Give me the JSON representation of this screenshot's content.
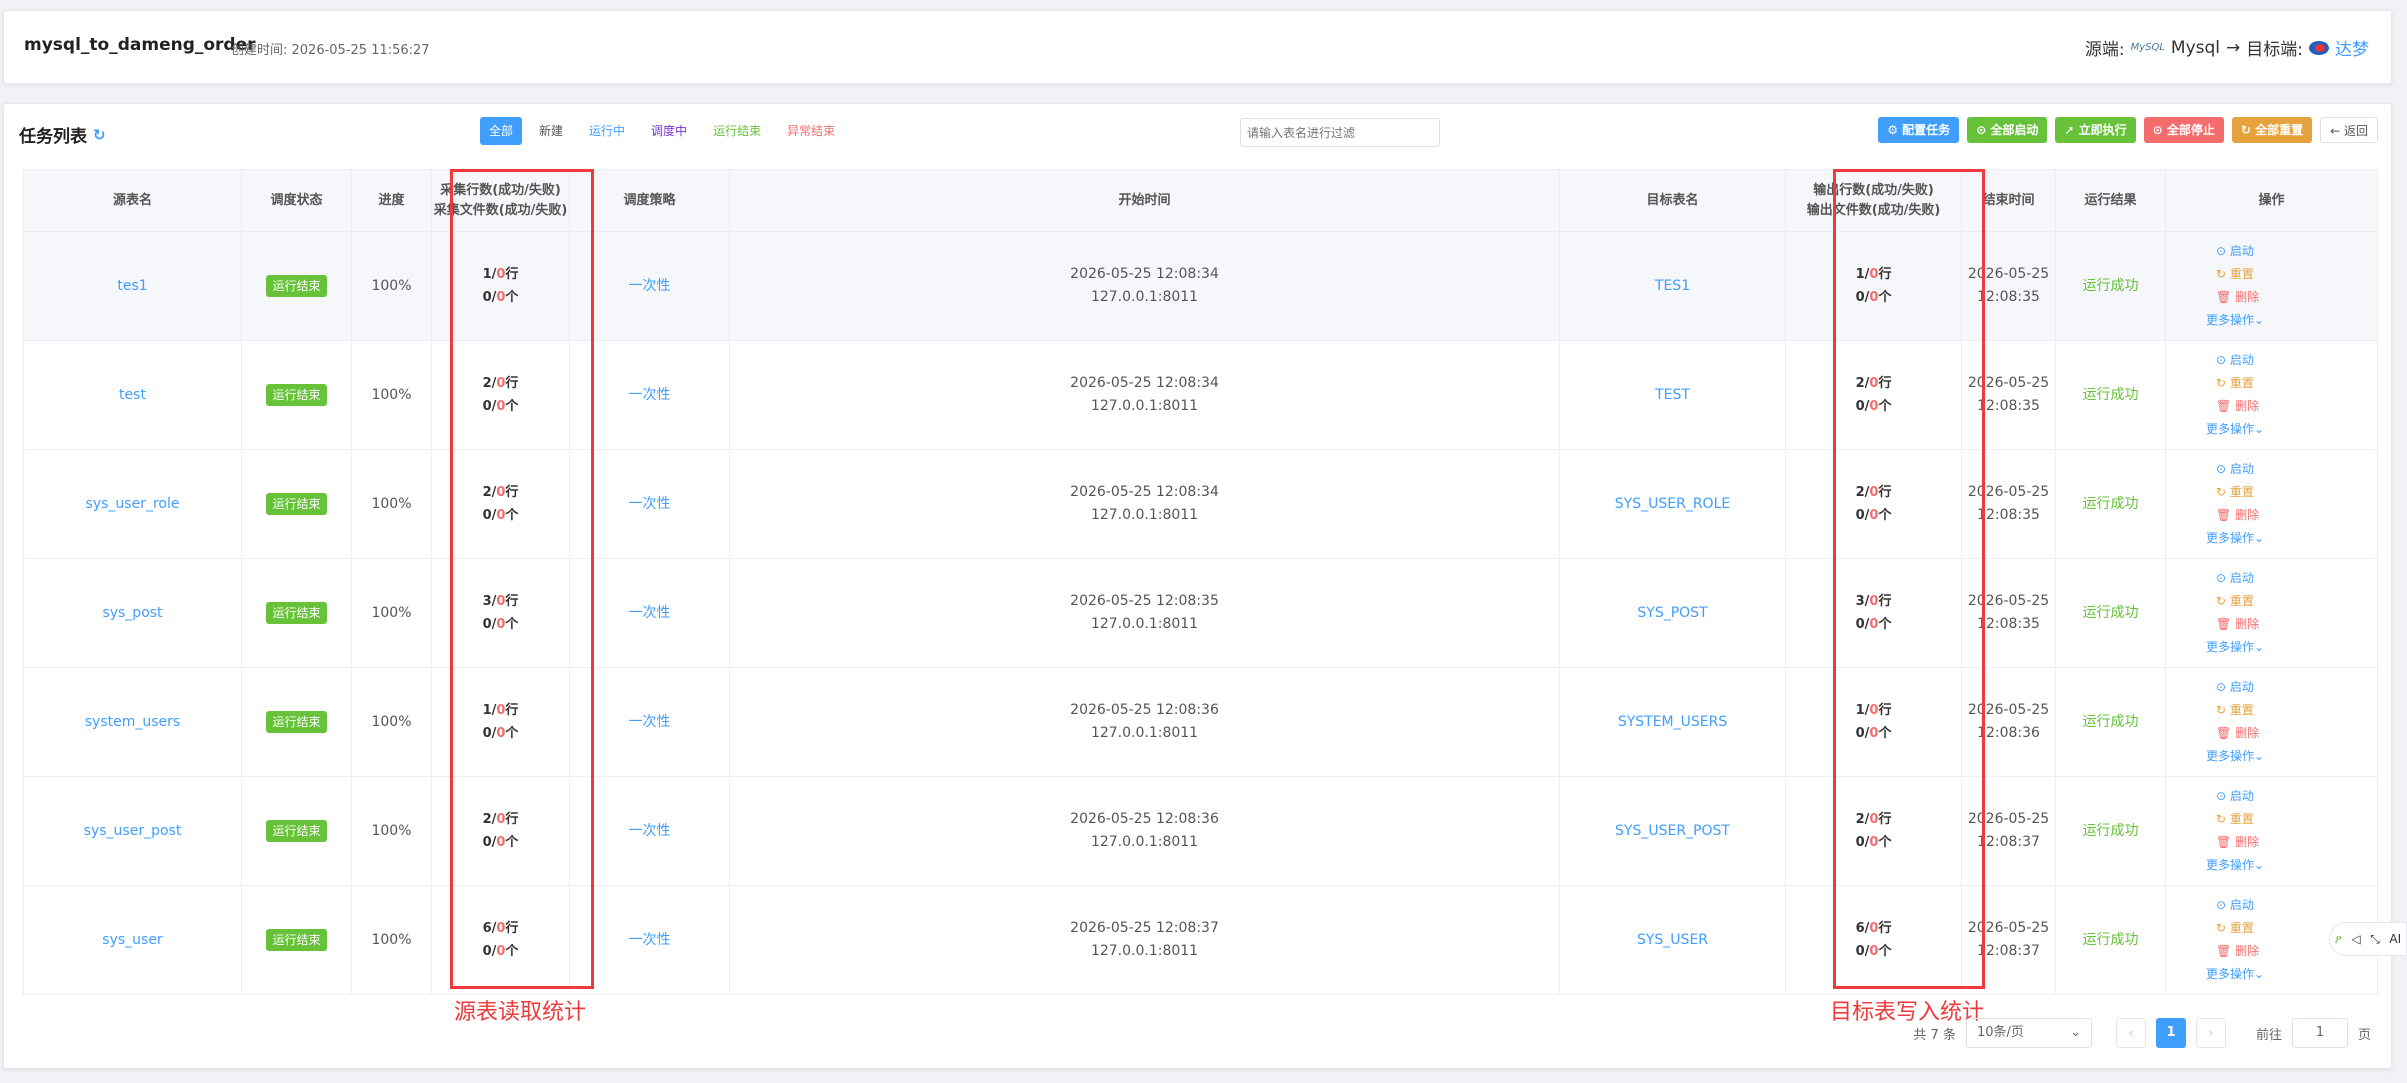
{
  "header": {
    "job_name": "mysql_to_dameng_order",
    "created_label": "创建时间: 2026-05-25 11:56:27",
    "source_label": "源端:",
    "source_logo_text": "MySQL",
    "source_name": "Mysql",
    "arrow": "→",
    "target_label": "目标端:",
    "target_name": "达梦"
  },
  "list": {
    "title": "任务列表",
    "refresh_icon": "↻",
    "filters": [
      "全部",
      "新建",
      "运行中",
      "调度中",
      "运行结束",
      "异常结束"
    ],
    "search_placeholder": "请输入表名进行过滤",
    "actions": {
      "config": "⚙ 配置任务",
      "start_all": "⊙ 全部启动",
      "run_now": "➚ 立即执行",
      "stop_all": "⊙ 全部停止",
      "reset_all": "↻ 全部重置",
      "back": "← 返回"
    }
  },
  "columns": {
    "src_table": "源表名",
    "sched_status": "调度状态",
    "progress": "进度",
    "collect_rows": "采集行数(成功/失败)",
    "collect_files": "采集文件数(成功/失败)",
    "strategy": "调度策略",
    "start_time": "开始时间",
    "target_table": "目标表名",
    "output_rows": "输出行数(成功/失败)",
    "output_files": "输出文件数(成功/失败)",
    "end_time": "结束时间",
    "result": "运行结果",
    "ops": "操作"
  },
  "row_labels": {
    "sep": "/",
    "row_unit": "行",
    "file_unit": "个",
    "op_start": "⊙ 启动",
    "op_reset": "↻ 重置",
    "op_delete": "🗑 删除",
    "op_more": "更多操作⌄"
  },
  "rows": [
    {
      "src": "tes1",
      "status": "运行结束",
      "progress": "100%",
      "c_ok": "1",
      "c_fail": "0",
      "f_ok": "0",
      "f_fail": "0",
      "strategy": "一次性",
      "start_date": "2026-05-25 12:08:34",
      "start_host": "127.0.0.1:8011",
      "target": "TES1",
      "o_ok": "1",
      "o_fail": "0",
      "of_ok": "0",
      "of_fail": "0",
      "end_date": "2026-05-25",
      "end_time": "12:08:35",
      "result": "运行成功"
    },
    {
      "src": "test",
      "status": "运行结束",
      "progress": "100%",
      "c_ok": "2",
      "c_fail": "0",
      "f_ok": "0",
      "f_fail": "0",
      "strategy": "一次性",
      "start_date": "2026-05-25 12:08:34",
      "start_host": "127.0.0.1:8011",
      "target": "TEST",
      "o_ok": "2",
      "o_fail": "0",
      "of_ok": "0",
      "of_fail": "0",
      "end_date": "2026-05-25",
      "end_time": "12:08:35",
      "result": "运行成功"
    },
    {
      "src": "sys_user_role",
      "status": "运行结束",
      "progress": "100%",
      "c_ok": "2",
      "c_fail": "0",
      "f_ok": "0",
      "f_fail": "0",
      "strategy": "一次性",
      "start_date": "2026-05-25 12:08:34",
      "start_host": "127.0.0.1:8011",
      "target": "SYS_USER_ROLE",
      "o_ok": "2",
      "o_fail": "0",
      "of_ok": "0",
      "of_fail": "0",
      "end_date": "2026-05-25",
      "end_time": "12:08:35",
      "result": "运行成功"
    },
    {
      "src": "sys_post",
      "status": "运行结束",
      "progress": "100%",
      "c_ok": "3",
      "c_fail": "0",
      "f_ok": "0",
      "f_fail": "0",
      "strategy": "一次性",
      "start_date": "2026-05-25 12:08:35",
      "start_host": "127.0.0.1:8011",
      "target": "SYS_POST",
      "o_ok": "3",
      "o_fail": "0",
      "of_ok": "0",
      "of_fail": "0",
      "end_date": "2026-05-25",
      "end_time": "12:08:35",
      "result": "运行成功"
    },
    {
      "src": "system_users",
      "status": "运行结束",
      "progress": "100%",
      "c_ok": "1",
      "c_fail": "0",
      "f_ok": "0",
      "f_fail": "0",
      "strategy": "一次性",
      "start_date": "2026-05-25 12:08:36",
      "start_host": "127.0.0.1:8011",
      "target": "SYSTEM_USERS",
      "o_ok": "1",
      "o_fail": "0",
      "of_ok": "0",
      "of_fail": "0",
      "end_date": "2026-05-25",
      "end_time": "12:08:36",
      "result": "运行成功"
    },
    {
      "src": "sys_user_post",
      "status": "运行结束",
      "progress": "100%",
      "c_ok": "2",
      "c_fail": "0",
      "f_ok": "0",
      "f_fail": "0",
      "strategy": "一次性",
      "start_date": "2026-05-25 12:08:36",
      "start_host": "127.0.0.1:8011",
      "target": "SYS_USER_POST",
      "o_ok": "2",
      "o_fail": "0",
      "of_ok": "0",
      "of_fail": "0",
      "end_date": "2026-05-25",
      "end_time": "12:08:37",
      "result": "运行成功"
    },
    {
      "src": "sys_user",
      "status": "运行结束",
      "progress": "100%",
      "c_ok": "6",
      "c_fail": "0",
      "f_ok": "0",
      "f_fail": "0",
      "strategy": "一次性",
      "start_date": "2026-05-25 12:08:37",
      "start_host": "127.0.0.1:8011",
      "target": "SYS_USER",
      "o_ok": "6",
      "o_fail": "0",
      "of_ok": "0",
      "of_fail": "0",
      "end_date": "2026-05-25",
      "end_time": "12:08:37",
      "result": "运行成功"
    }
  ],
  "annotations": {
    "source_stats": "源表读取统计",
    "target_stats": "目标表写入统计"
  },
  "pagination": {
    "total": "共 7 条",
    "page_size": "10条/页",
    "prev": "‹",
    "current": "1",
    "next": "›",
    "goto_label": "前往",
    "goto_value": "1",
    "page_unit": "页"
  },
  "floatbar": {
    "items": [
      "ዖ",
      "◁",
      "⤡",
      "AI"
    ]
  },
  "colors": {
    "primary": "#409eff",
    "success": "#67c23a",
    "danger": "#f56c6c",
    "warning": "#e6a23c",
    "highlight": "#ee3a3a"
  }
}
